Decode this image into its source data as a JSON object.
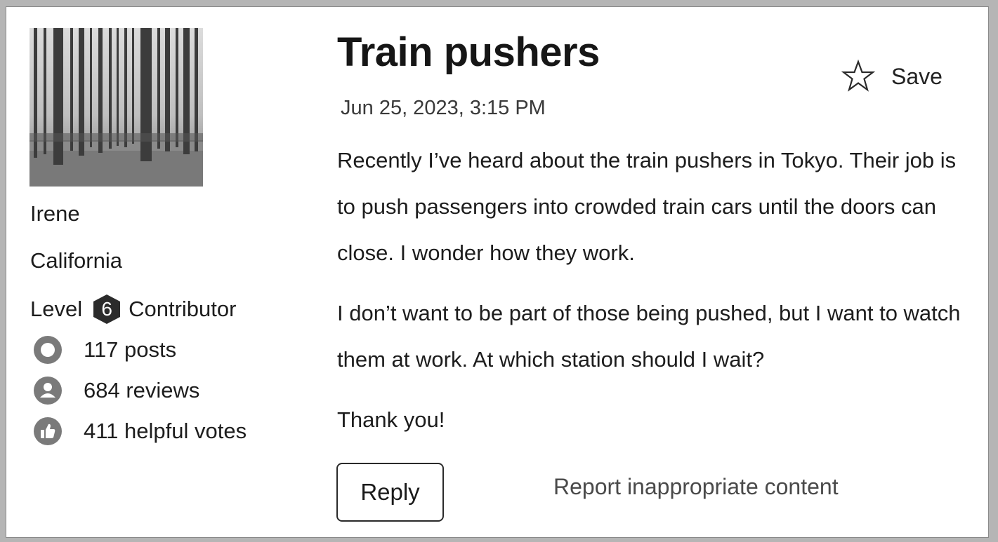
{
  "user": {
    "name": "Irene",
    "location": "California",
    "level_prefix": "Level",
    "level_number": "6",
    "level_suffix": "Contributor",
    "stats": {
      "posts": "117 posts",
      "reviews": "684 reviews",
      "helpful_votes": "411 helpful votes"
    }
  },
  "post": {
    "title": "Train pushers",
    "save_label": "Save",
    "date": "Jun 25, 2023, 3:15 PM",
    "paragraphs": [
      "Recently I’ve heard about the train pushers in Tokyo. Their job is to push passengers into crowded train cars until the doors can close. I wonder how they work.",
      "I don’t want to be part of those being pushed, but I want to watch them at work. At which station should I wait?",
      "Thank you!"
    ]
  },
  "actions": {
    "reply_label": "Reply",
    "report_label": "Report inappropriate content"
  },
  "icons": {
    "avatar": "forest-photo",
    "level_badge": "hexagon-badge-icon",
    "posts": "post-circle-icon",
    "reviews": "person-icon",
    "helpful_votes": "thumbs-up-icon",
    "save": "star-outline-icon"
  },
  "colors": {
    "frame": "#b5b5b5",
    "icon_gray": "#7a7a7a",
    "badge": "#2b2b2b",
    "text": "#1d1d1d"
  }
}
